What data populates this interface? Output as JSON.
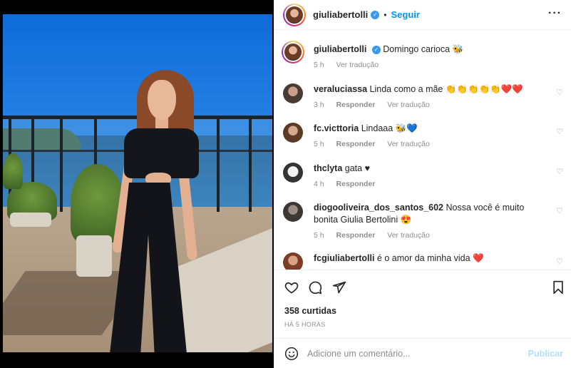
{
  "post": {
    "username": "giuliabertolli",
    "verified_icon": "verified-badge-icon",
    "follow_label": "Seguir",
    "more_icon": "more-options-icon",
    "caption": {
      "text": "Domingo carioca 🐝",
      "time": "5 h",
      "translate": "Ver tradução"
    }
  },
  "comments": [
    {
      "user": "veraluciassa",
      "text": "Linda como a mãe 👏👏👏👏👏❤️❤️",
      "time": "3 h",
      "reply": "Responder",
      "translate": "Ver tradução"
    },
    {
      "user": "fc.victtoria",
      "text": "Lindaaa 🐝💙",
      "time": "5 h",
      "reply": "Responder",
      "translate": "Ver tradução"
    },
    {
      "user": "thclyta",
      "text": "gata ♥",
      "time": "4 h",
      "reply": "Responder"
    },
    {
      "user": "diogooliveira_dos_santos_602",
      "text": "Nossa você é muito bonita Giulia Bertolini 😍",
      "time": "5 h",
      "reply": "Responder",
      "translate": "Ver tradução"
    },
    {
      "user": "fcgiuliabertolli",
      "text": "é o amor da minha vida ❤️"
    }
  ],
  "actions": {
    "like_icon": "heart-icon",
    "comment_icon": "comment-icon",
    "share_icon": "share-icon",
    "save_icon": "bookmark-icon",
    "likes": "358 curtidas",
    "time": "HÁ 5 HORAS"
  },
  "composer": {
    "emoji_icon": "emoji-icon",
    "placeholder": "Adicione um comentário...",
    "publish_label": "Publicar"
  },
  "colors": {
    "link_blue": "#0095f6",
    "publish_disabled": "#b2dffc",
    "meta_gray": "#8e8e8e",
    "text": "#262626"
  }
}
